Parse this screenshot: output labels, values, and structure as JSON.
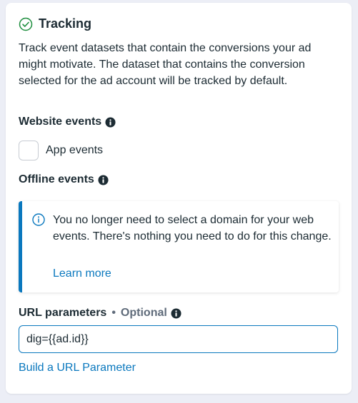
{
  "tracking": {
    "title": "Tracking",
    "status_icon": "check-circle-icon",
    "description": "Track event datasets that contain the conversions your ad might motivate. The dataset that contains the conversion selected for the ad account will be tracked by default."
  },
  "website_events": {
    "label": "Website events",
    "icon": "info-icon"
  },
  "app_events": {
    "label": "App events",
    "checked": false
  },
  "offline_events": {
    "label": "Offline events",
    "icon": "info-icon"
  },
  "notice": {
    "icon": "info-outline-icon",
    "text": "You no longer need to select a domain for your web events. There's nothing you need to do for this change.",
    "link_label": "Learn more",
    "accent_color": "#0a78be"
  },
  "url_parameters": {
    "label": "URL parameters",
    "separator": "•",
    "optional_label": "Optional",
    "icon": "info-icon",
    "value": "dig={{ad.id}}"
  },
  "build_link": {
    "label": "Build a URL Parameter"
  },
  "colors": {
    "link": "#0a78be",
    "success": "#1e8e3e",
    "text": "#1c2b33",
    "muted": "#5f6b7a"
  }
}
